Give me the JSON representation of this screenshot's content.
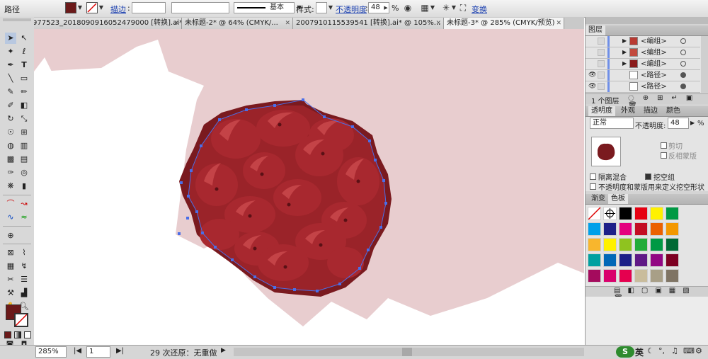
{
  "control_bar": {
    "object_type": "路径",
    "stroke_label": "描边",
    "stroke_weight": "",
    "profile_value": "",
    "brush_label": "基本",
    "style_label": "样式",
    "opacity_label": "不透明度",
    "opacity_value": "48",
    "percent_sign": "%",
    "transform_label": "变换",
    "fill_color": "#6b1a1a"
  },
  "tabs": [
    {
      "label": "977523_2018090916052479000 [转换].ai*",
      "active": false
    },
    {
      "label": "未标题-2* @ 64% (CMYK/...",
      "active": false
    },
    {
      "label": "2007910115539541 [转换].ai* @ 105%...",
      "active": false
    },
    {
      "label": "未标题-3* @ 285% (CMYK/预览)",
      "active": true
    }
  ],
  "status_bar": {
    "zoom": "285%",
    "artboard": "1",
    "status_text": "29 次还原：无重做"
  },
  "layers_panel": {
    "title": "图层",
    "rows": [
      {
        "name": "<编组>",
        "thumb": "#b83a32",
        "visible": false
      },
      {
        "name": "<编组>",
        "thumb": "#c24a3e",
        "visible": false
      },
      {
        "name": "<编组>",
        "thumb": "#8a1a1a",
        "visible": false
      },
      {
        "name": "<路径>",
        "thumb": "#ffffff",
        "visible": true
      },
      {
        "name": "<路径>",
        "thumb": "#ffffff",
        "visible": true
      }
    ],
    "footer_count": "1 个图层"
  },
  "transparency_panel": {
    "tabs": [
      "透明度",
      "外观",
      "描边",
      "颜色"
    ],
    "blend_mode": "正常",
    "opacity_label": "不透明度",
    "opacity_value": "48",
    "clip_label": "剪切",
    "invert_mask_label": "反相蒙版",
    "isolate_label": "隔离混合",
    "knockout_label": "挖空组",
    "define_knockout_label": "不透明度和蒙版用来定义挖空形状"
  },
  "swatches_panel": {
    "tabs": [
      "渐变",
      "色板"
    ],
    "colors": [
      "#ffffff",
      "#ffffff",
      "#000000",
      "#e60012",
      "#fff100",
      "#009944",
      "#00a0e9",
      "#1d2088",
      "#e4007f",
      "#c30d23",
      "#eb6100",
      "#f39800",
      "#f8b62d",
      "#fff100",
      "#8fc31f",
      "#22ac38",
      "#009944",
      "#006934",
      "#00a0a0",
      "#0068b7",
      "#1d2088",
      "#601986",
      "#920783",
      "#7d0022",
      "#a40b5d",
      "#d9006c",
      "#e5004f",
      "#c9bc9c",
      "#a89f87",
      "#7f7464"
    ]
  },
  "taskbar": {
    "ime_label": "英"
  }
}
